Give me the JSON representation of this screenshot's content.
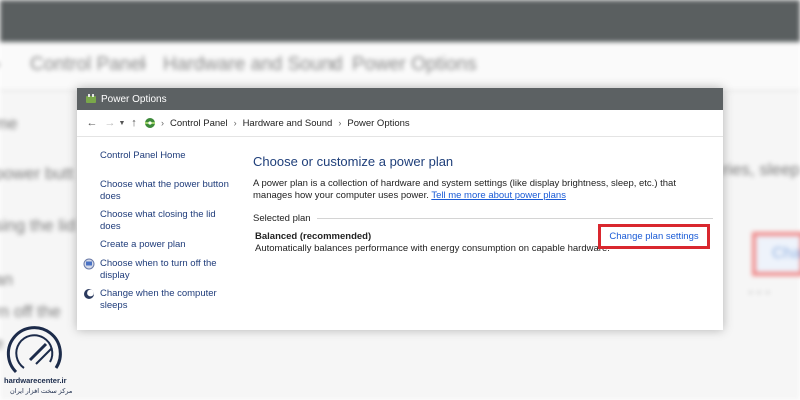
{
  "background": {
    "breadcrumb": [
      "Control Panel",
      "Hardware and Sound",
      "Power Options"
    ],
    "sidebar_fragments": [
      "me",
      "power butt",
      "sing the lid",
      "an",
      "rn off the",
      "e"
    ],
    "right_text": "ries, sleep",
    "right_button": "Chan"
  },
  "window": {
    "title": "Power Options",
    "nav": {
      "back_icon": "arrow-left-icon",
      "forward_icon": "arrow-right-icon",
      "recent_icon": "chevron-down-icon",
      "up_icon": "arrow-up-icon"
    },
    "breadcrumb": [
      "Control Panel",
      "Hardware and Sound",
      "Power Options"
    ]
  },
  "sidebar": {
    "home": "Control Panel Home",
    "items": [
      {
        "label": "Choose what the power button does"
      },
      {
        "label": "Choose what closing the lid does"
      },
      {
        "label": "Create a power plan"
      },
      {
        "label": "Choose when to turn off the display",
        "icon": "monitor-icon"
      },
      {
        "label": "Change when the computer sleeps",
        "icon": "moon-icon"
      }
    ]
  },
  "main": {
    "heading": "Choose or customize a power plan",
    "description": "A power plan is a collection of hardware and system settings (like display brightness, sleep, etc.) that manages how your computer uses power.",
    "description_link": "Tell me more about power plans",
    "selected_plan_label": "Selected plan",
    "plan_name": "Balanced (recommended)",
    "plan_description": "Automatically balances performance with energy consumption on capable hardware.",
    "change_plan_link": "Change plan settings"
  },
  "logo": {
    "name": "hardwarecenter.ir",
    "tagline": "مرکز سخت افزار ایران"
  },
  "colors": {
    "titlebar": "#5c6163",
    "link": "#1a5bd6",
    "heading": "#1f3f7a",
    "highlight": "#d9272e"
  }
}
